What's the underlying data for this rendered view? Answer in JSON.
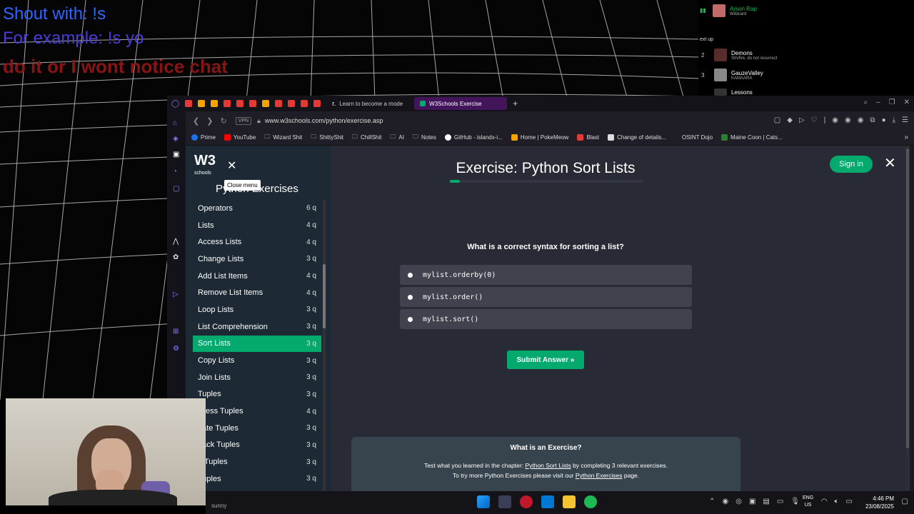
{
  "stream_overlay": {
    "line1": "Shout with: !s",
    "line2": "For example: !s yo",
    "line3": "do it or I wont notice chat"
  },
  "spotify": {
    "now_playing": {
      "title": "Arson Rap",
      "artist": "Wildcard"
    },
    "next_up_label": "ext up",
    "queue": [
      {
        "num": "2",
        "title": "Demons",
        "artist": "Strvfire, do not resurrect"
      },
      {
        "num": "3",
        "title": "GauzeValley",
        "artist": "KAMAARA"
      },
      {
        "num": "",
        "title": "Lessons",
        "artist": ""
      }
    ]
  },
  "browser": {
    "tabs": [
      {
        "label": "Learn to become a mode",
        "active": false
      },
      {
        "label": "W3Schools Exercise",
        "active": true
      }
    ],
    "vpn_label": "VPN",
    "url": "www.w3schools.com/python/exercise.asp",
    "bookmarks": [
      {
        "label": "Prime",
        "color": "#1a73e8"
      },
      {
        "label": "YouTube",
        "color": "#ff0000"
      },
      {
        "label": "Wizard Shit",
        "color": "#888888"
      },
      {
        "label": "ShittyShit",
        "color": "#888888"
      },
      {
        "label": "ChillShit",
        "color": "#888888"
      },
      {
        "label": "AI",
        "color": "#888888"
      },
      {
        "label": "Notes",
        "color": "#888888"
      },
      {
        "label": "GitHub - islandx-i...",
        "color": "#ffffff"
      },
      {
        "label": "Home | PokeMeow",
        "color": "#f4a300"
      },
      {
        "label": "Blast",
        "color": "#e53935"
      },
      {
        "label": "Change of details...",
        "color": "#dddddd"
      },
      {
        "label": "OSINT Dojo",
        "color": "#444444"
      },
      {
        "label": "Maine Coon | Cats...",
        "color": "#2e7d32"
      }
    ]
  },
  "w3": {
    "logo": "W3",
    "logo_sub": "schools",
    "tooltip": "Close menu",
    "menu_heading": "Python Exercises",
    "menu_items": [
      {
        "label": "Operators",
        "count": "6 q",
        "active": false
      },
      {
        "label": "Lists",
        "count": "4 q",
        "active": false
      },
      {
        "label": "Access Lists",
        "count": "4 q",
        "active": false
      },
      {
        "label": "Change Lists",
        "count": "3 q",
        "active": false
      },
      {
        "label": "Add List Items",
        "count": "4 q",
        "active": false
      },
      {
        "label": "Remove List Items",
        "count": "4 q",
        "active": false
      },
      {
        "label": "Loop Lists",
        "count": "3 q",
        "active": false
      },
      {
        "label": "List Comprehension",
        "count": "3 q",
        "active": false
      },
      {
        "label": "Sort Lists",
        "count": "3 q",
        "active": true
      },
      {
        "label": "Copy Lists",
        "count": "3 q",
        "active": false
      },
      {
        "label": "Join Lists",
        "count": "3 q",
        "active": false
      },
      {
        "label": "Tuples",
        "count": "3 q",
        "active": false
      },
      {
        "label": "ccess Tuples",
        "count": "4 q",
        "active": false
      },
      {
        "label": "date Tuples",
        "count": "3 q",
        "active": false
      },
      {
        "label": "pack Tuples",
        "count": "3 q",
        "active": false
      },
      {
        "label": "p Tuples",
        "count": "3 q",
        "active": false
      },
      {
        "label": "Tuples",
        "count": "3 q",
        "active": false
      }
    ],
    "exercise_title": "Exercise: Python Sort Lists",
    "progress": 0.05,
    "sign_in": "Sign in",
    "question": "What is a correct syntax for sorting a list?",
    "options": [
      "mylist.orderby(0)",
      "mylist.order()",
      "mylist.sort()"
    ],
    "submit": "Submit Answer »",
    "info": {
      "title": "What is an Exercise?",
      "l1_pre": "Test what you learned in the chapter: ",
      "l1_link": "Python Sort Lists",
      "l1_post": " by completing 3 relevant exercises.",
      "l2_pre": "To try more Python Exercises please visit our ",
      "l2_link": "Python Exercises",
      "l2_post": " page."
    }
  },
  "webcam": {
    "label": "sunny"
  },
  "taskbar": {
    "lang1": "ENG",
    "lang2": "US",
    "time": "4:46 PM",
    "date": "23/08/2025"
  },
  "colors": {
    "accent": "#04aa6d",
    "page_bg": "#282a35",
    "menu_bg": "#1d2a35"
  }
}
